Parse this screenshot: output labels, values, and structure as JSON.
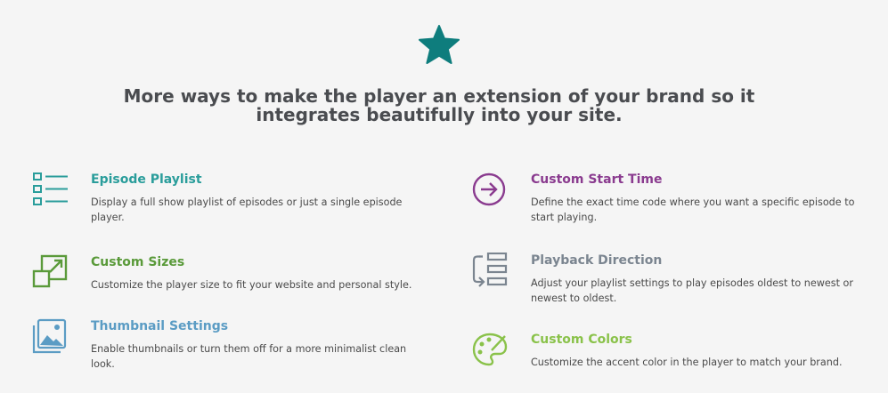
{
  "header": {
    "icon": "star-icon",
    "headline": "More ways to make the player an extension of your brand so it integrates beautifully into your site."
  },
  "colors": {
    "teal": "#0e7d7d",
    "playlist": "#2a9d9b",
    "sizes": "#5a9a3a",
    "thumbnail": "#5b9cc4",
    "start_time": "#8a3b8f",
    "playback": "#7b8590",
    "custom_colors": "#8ac24a"
  },
  "features": {
    "left": [
      {
        "icon": "playlist-icon",
        "title": "Episode Playlist",
        "description": "Display a full show playlist of episodes or just a single episode player."
      },
      {
        "icon": "resize-icon",
        "title": "Custom Sizes",
        "description": "Customize the player size to fit your website and personal style."
      },
      {
        "icon": "image-icon",
        "title": "Thumbnail Settings",
        "description": "Enable thumbnails or turn them off for a more minimalist clean look."
      }
    ],
    "right": [
      {
        "icon": "arrow-right-circle-icon",
        "title": "Custom Start Time",
        "description": "Define the exact time code where you want a specific episode to start playing."
      },
      {
        "icon": "reorder-icon",
        "title": "Playback Direction",
        "description": "Adjust your playlist settings to play episodes oldest to newest or newest to oldest."
      },
      {
        "icon": "palette-icon",
        "title": "Custom Colors",
        "description": "Customize the accent color in the player to match your brand."
      }
    ]
  }
}
